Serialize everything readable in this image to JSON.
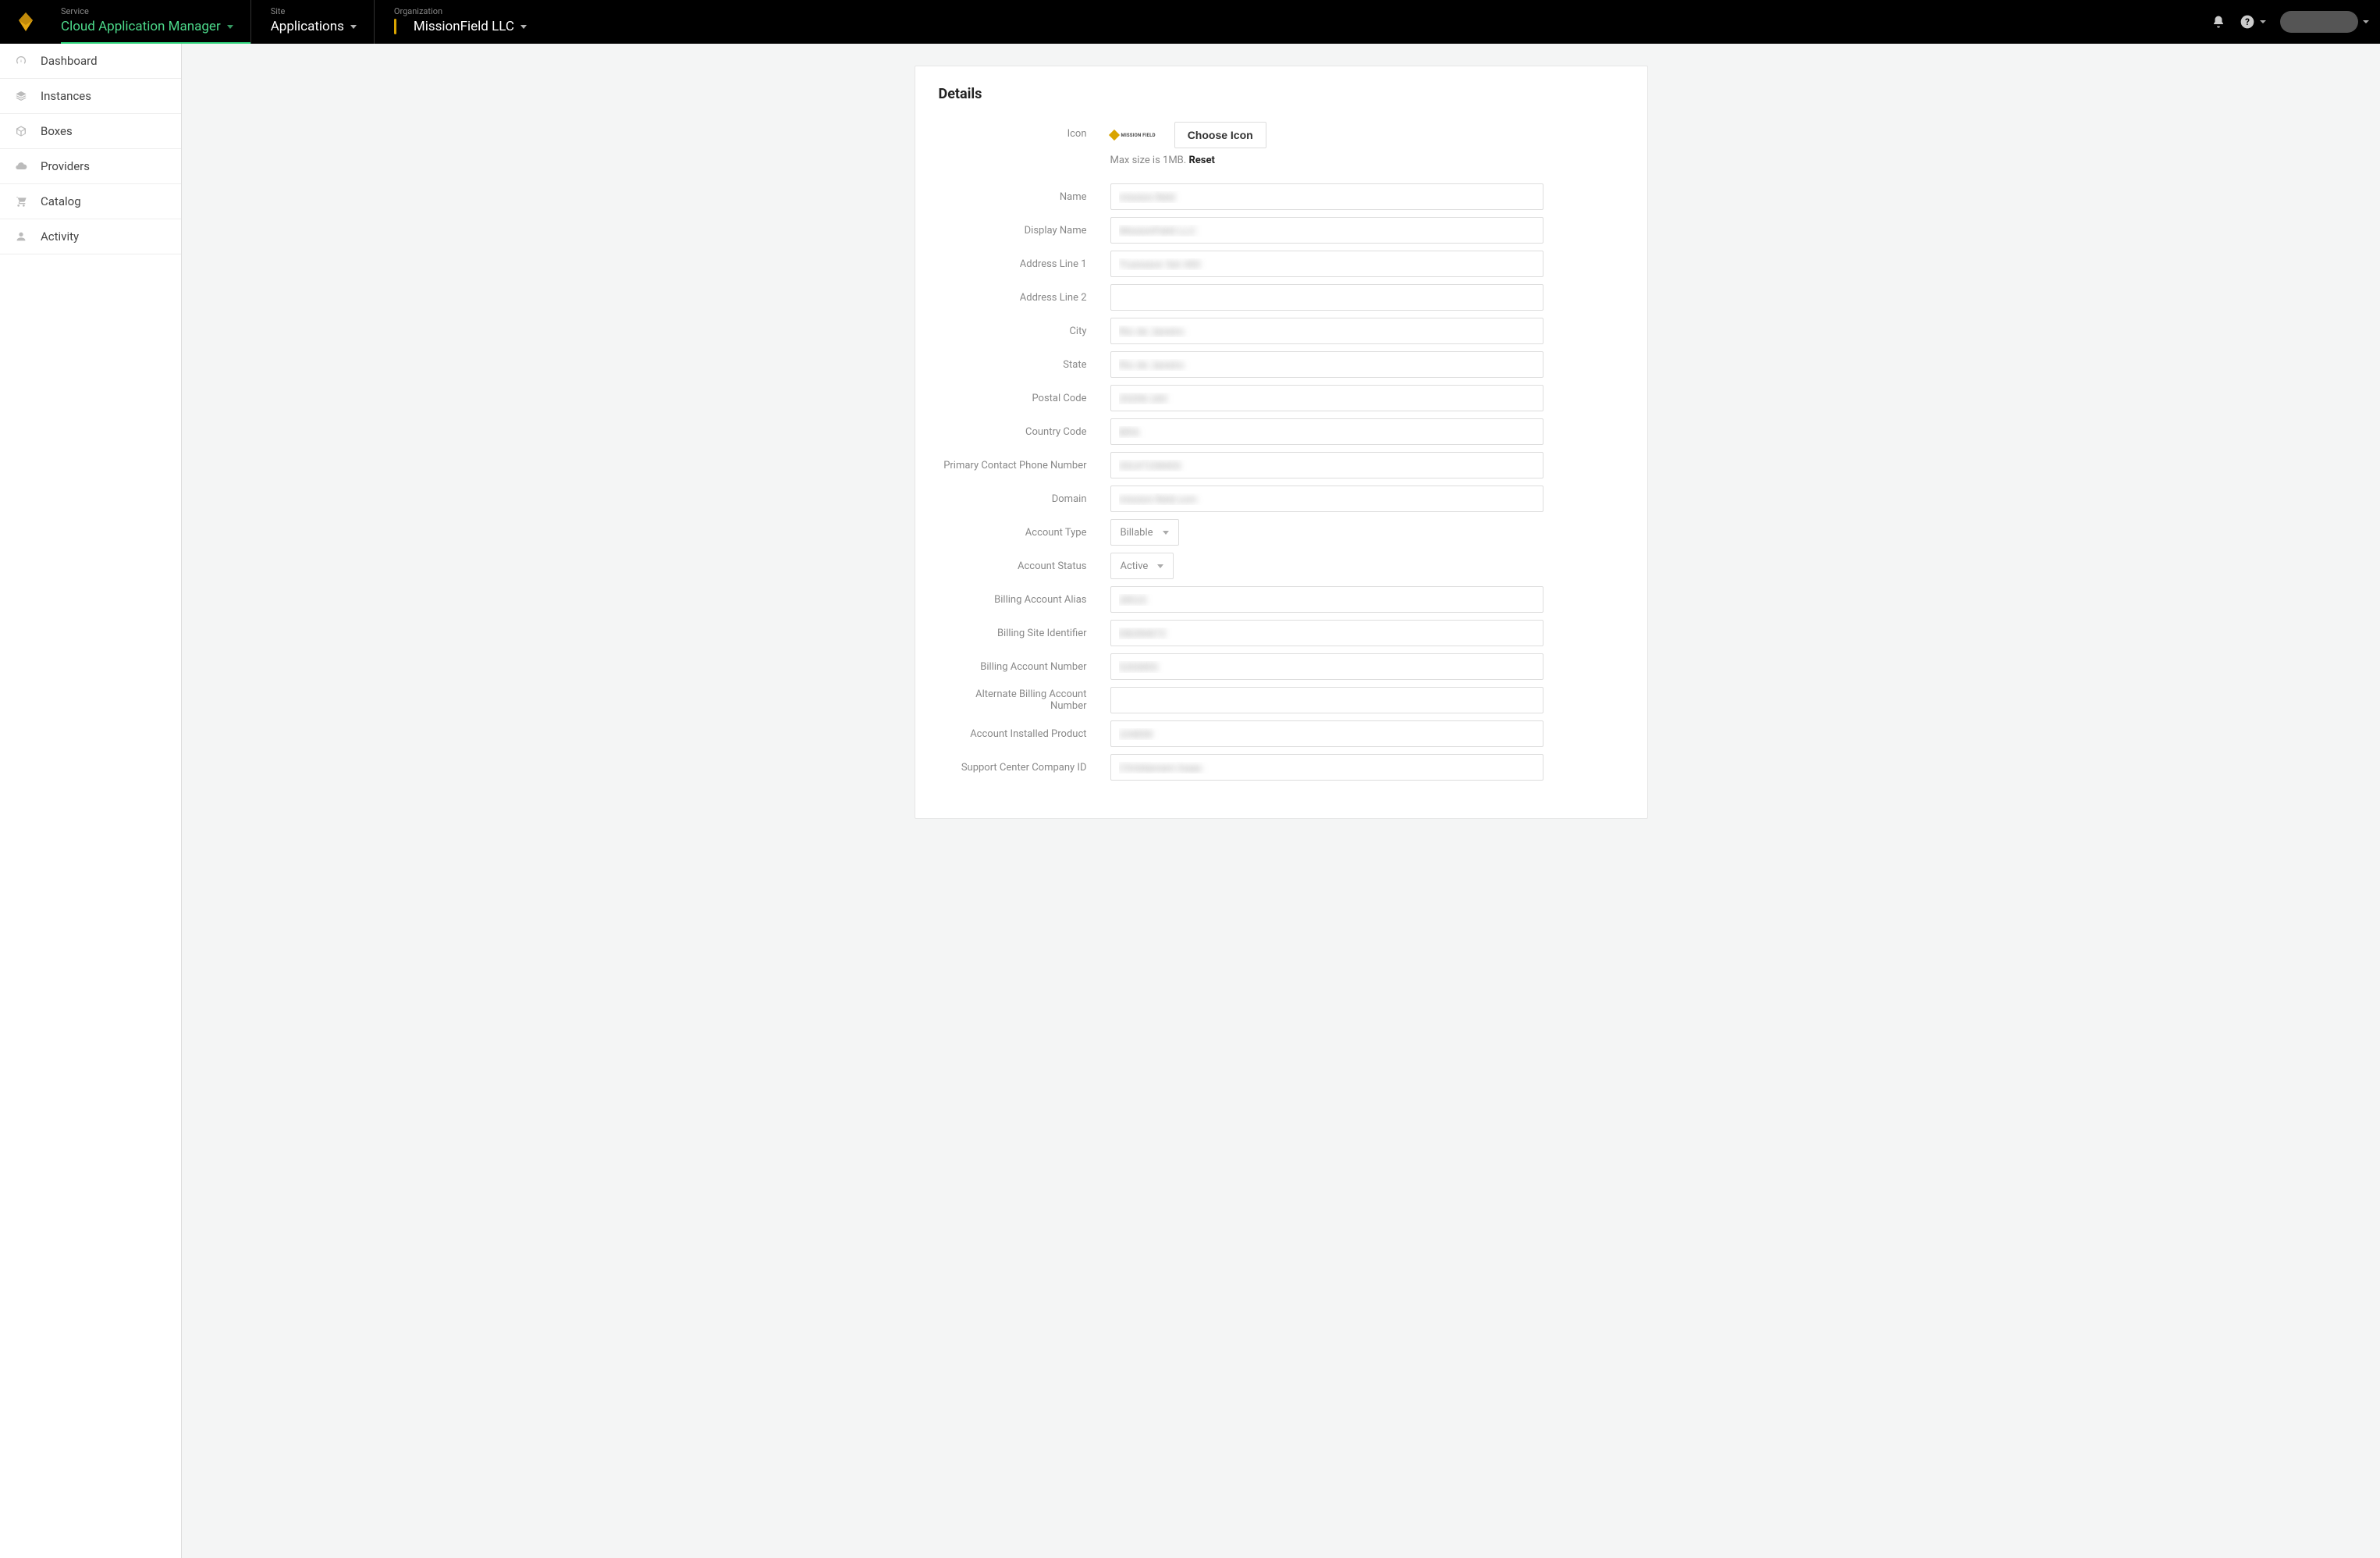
{
  "topbar": {
    "service_label": "Service",
    "service_value": "Cloud Application Manager",
    "site_label": "Site",
    "site_value": "Applications",
    "org_label": "Organization",
    "org_value": "MissionField LLC"
  },
  "sidebar": {
    "items": [
      {
        "label": "Dashboard",
        "icon": "gauge"
      },
      {
        "label": "Instances",
        "icon": "layers"
      },
      {
        "label": "Boxes",
        "icon": "cube"
      },
      {
        "label": "Providers",
        "icon": "cloud"
      },
      {
        "label": "Catalog",
        "icon": "cart"
      },
      {
        "label": "Activity",
        "icon": "user"
      }
    ]
  },
  "panel": {
    "title": "Details",
    "icon_section": {
      "label": "Icon",
      "preview_text": "MISSION FIELD",
      "choose_button": "Choose Icon",
      "hint_text": "Max size is 1MB. ",
      "reset": "Reset"
    },
    "fields": [
      {
        "label": "Name",
        "value": "mission-field",
        "blur": true
      },
      {
        "label": "Display Name",
        "value": "MissionField LLC",
        "blur": true
      },
      {
        "label": "Address Line 1",
        "value": "Truewave Set 400",
        "blur": true
      },
      {
        "label": "Address Line 2",
        "value": "",
        "blur": false
      },
      {
        "label": "City",
        "value": "Rio de Janeiro",
        "blur": true
      },
      {
        "label": "State",
        "value": "Rio de Janeiro",
        "blur": true
      },
      {
        "label": "Postal Code",
        "value": "20206-160",
        "blur": true
      },
      {
        "label": "Country Code",
        "value": "BRA",
        "blur": true
      },
      {
        "label": "Primary Contact Phone Number",
        "value": "33147158403",
        "blur": true
      },
      {
        "label": "Domain",
        "value": "mission-field.com",
        "blur": true
      }
    ],
    "account_type": {
      "label": "Account Type",
      "value": "Billable"
    },
    "account_status": {
      "label": "Account Status",
      "value": "Active"
    },
    "fields2": [
      {
        "label": "Billing Account Alias",
        "value": "28515",
        "blur": true
      },
      {
        "label": "Billing Site Identifier",
        "value": "EB284672",
        "blur": true
      },
      {
        "label": "Billing Account Number",
        "value": "5293955",
        "blur": true
      },
      {
        "label": "Alternate Billing Account Number",
        "value": "",
        "blur": false
      },
      {
        "label": "Account Installed Product",
        "value": "104839",
        "blur": true
      },
      {
        "label": "Support Center Company ID",
        "value": "Christiansen-Isaac",
        "blur": true
      }
    ]
  }
}
